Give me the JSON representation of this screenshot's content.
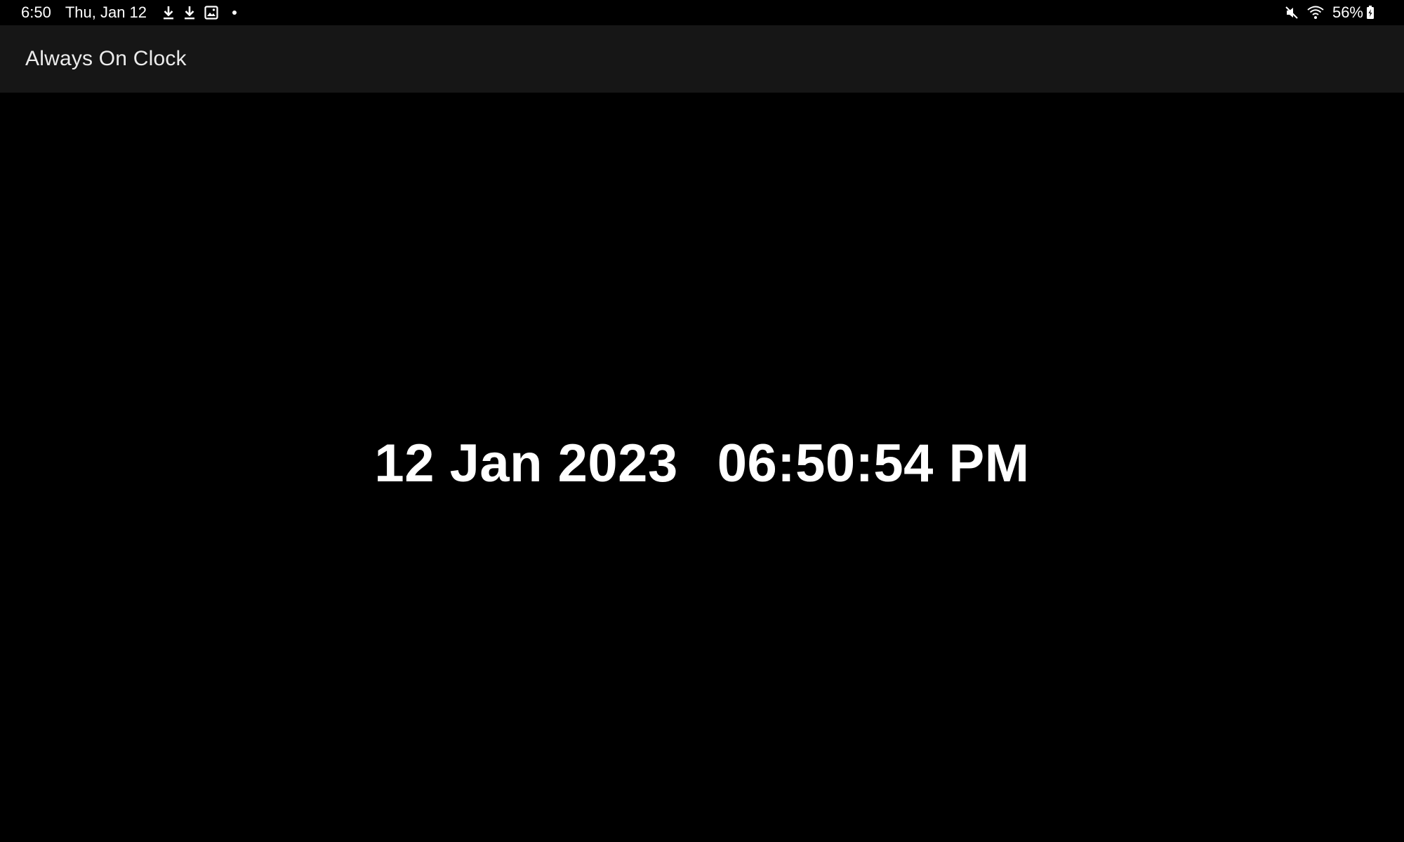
{
  "status_bar": {
    "time": "6:50",
    "date": "Thu, Jan 12",
    "left_icons": [
      "download-icon",
      "download-icon",
      "image-icon",
      "dot-icon"
    ],
    "right_icons": [
      "mute-icon",
      "wifi-icon"
    ],
    "battery_percent": "56%"
  },
  "app_bar": {
    "title": "Always On Clock"
  },
  "clock": {
    "date": "12 Jan 2023",
    "time": "06:50:54 PM"
  },
  "colors": {
    "background": "#000000",
    "app_bar": "#161616",
    "text": "#ffffff"
  }
}
